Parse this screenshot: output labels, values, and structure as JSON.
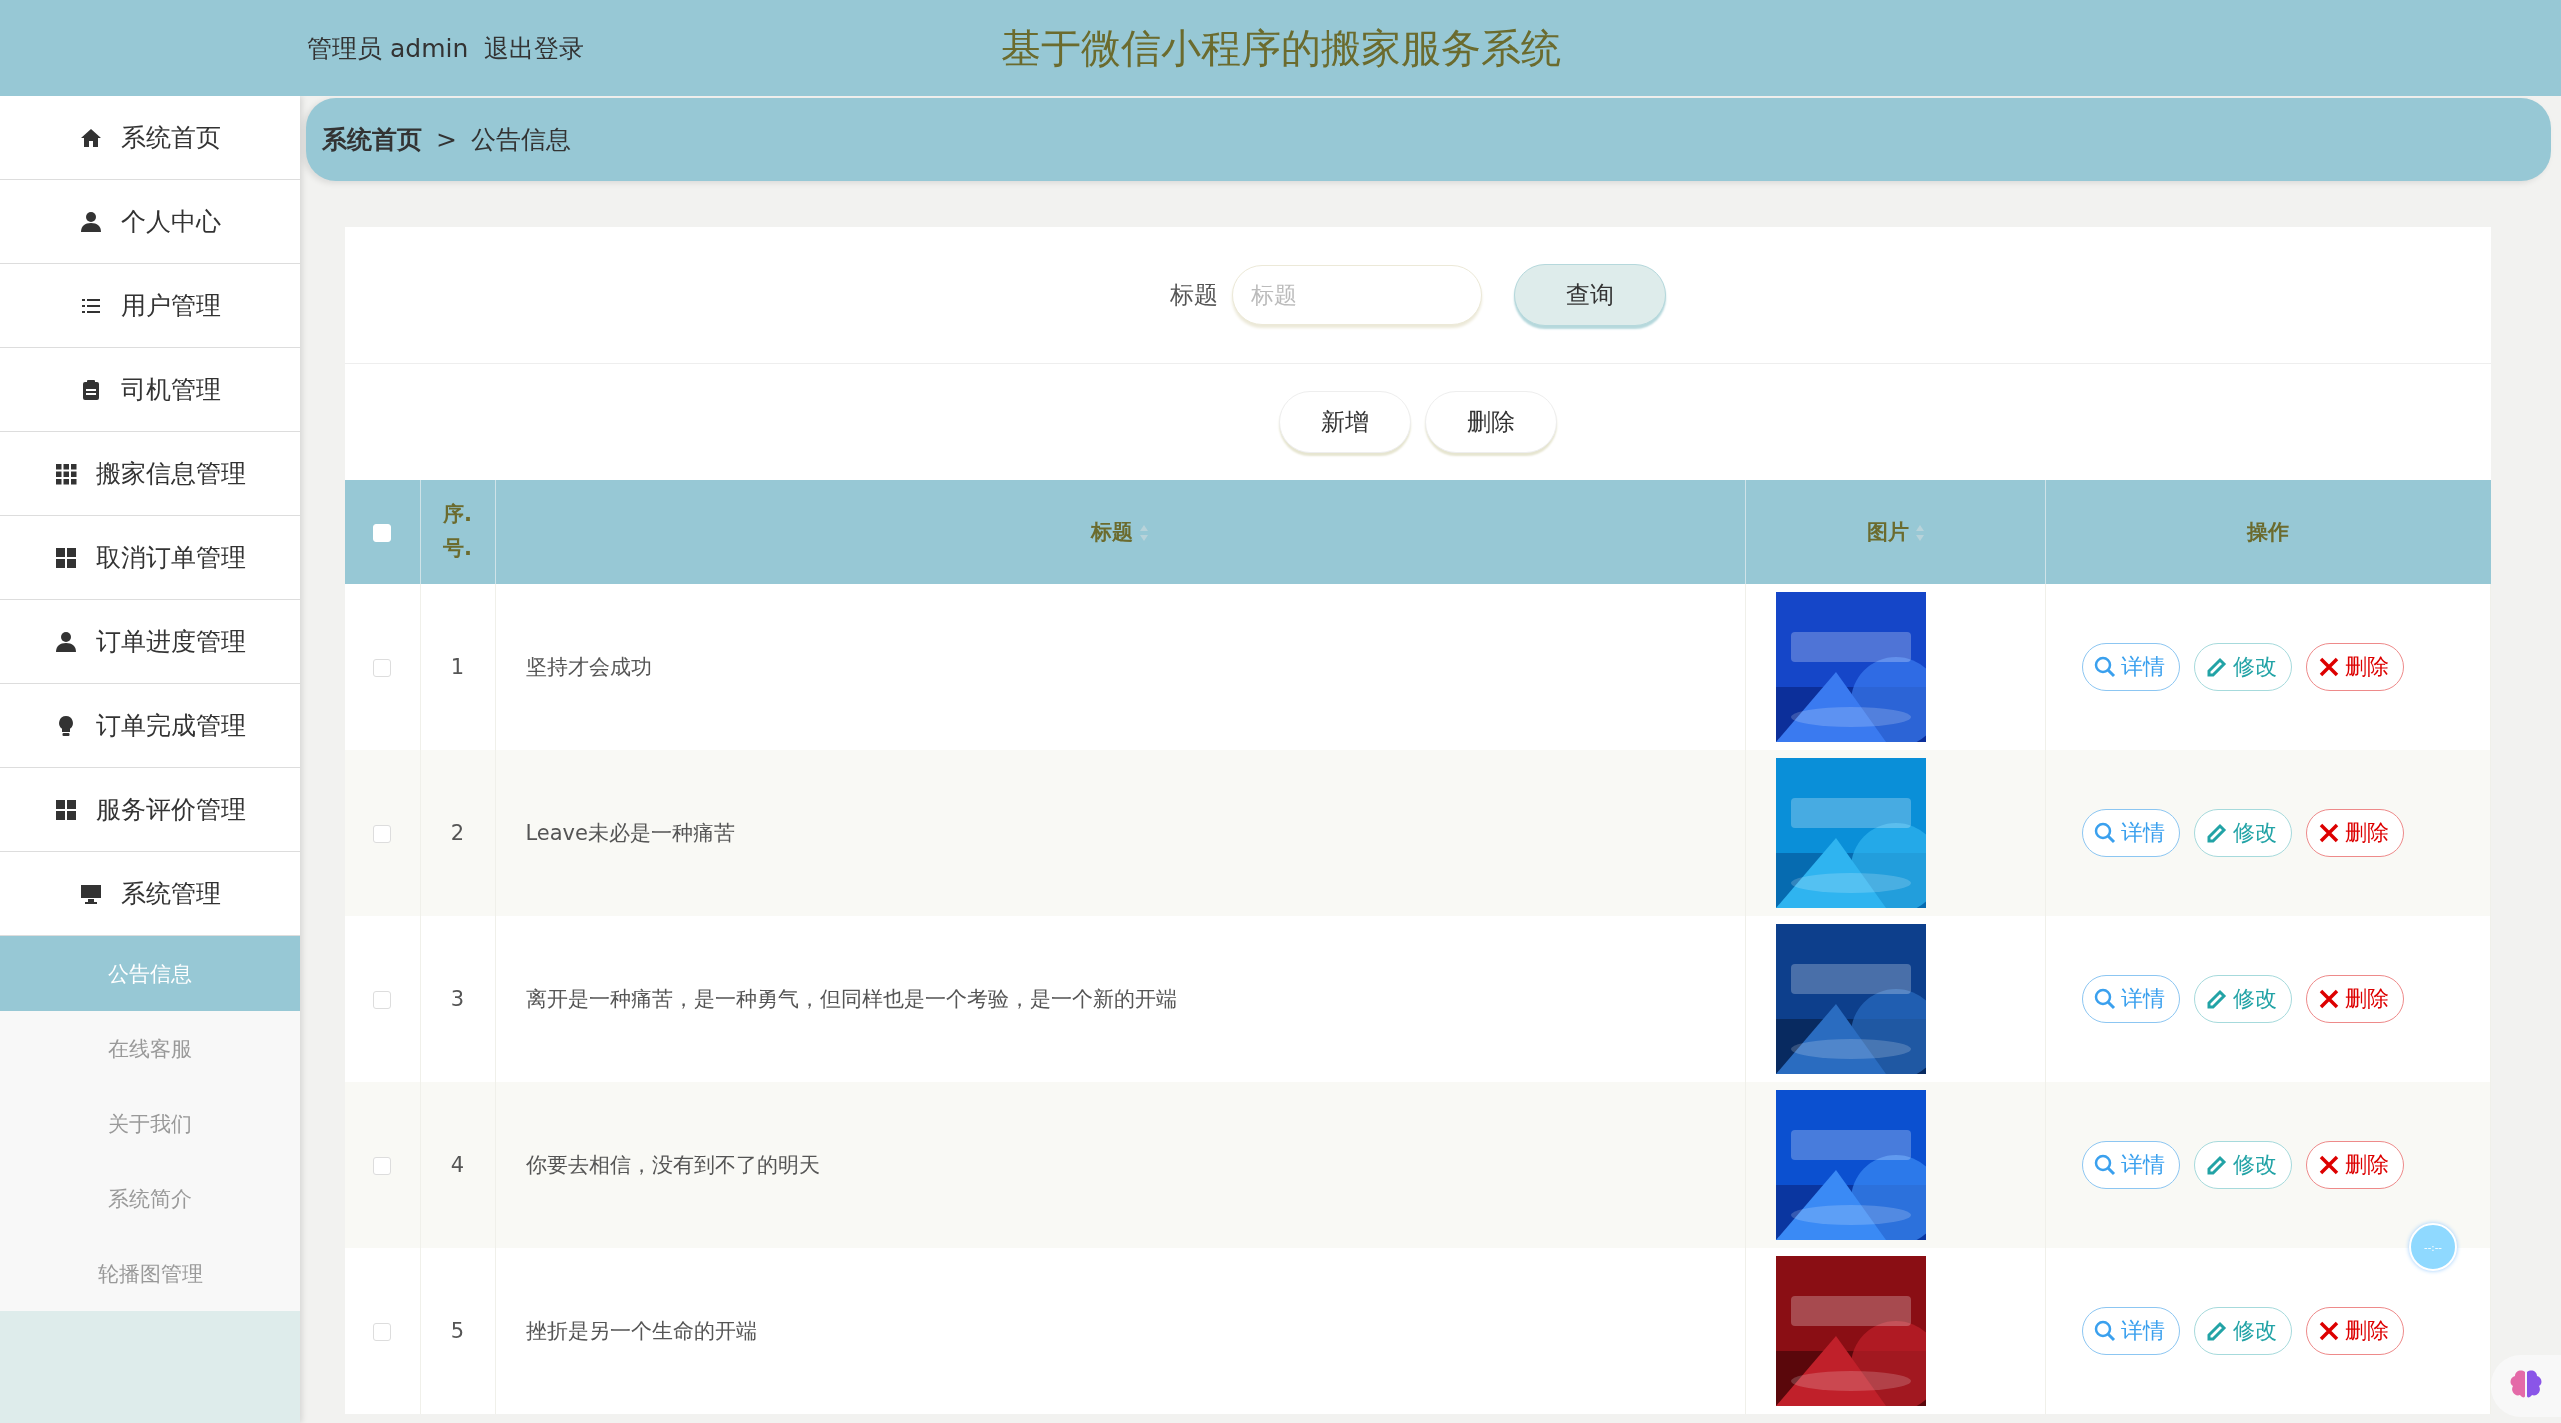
{
  "header": {
    "user_label": "管理员 admin",
    "logout": "退出登录",
    "title": "基于微信小程序的搬家服务系统"
  },
  "sidebar": {
    "items": [
      {
        "label": "系统首页",
        "selected": false
      },
      {
        "label": "个人中心",
        "selected": false
      },
      {
        "label": "用户管理",
        "selected": false
      },
      {
        "label": "司机管理",
        "selected": false
      },
      {
        "label": "搬家信息管理",
        "selected": false
      },
      {
        "label": "取消订单管理",
        "selected": false
      },
      {
        "label": "订单进度管理",
        "selected": false
      },
      {
        "label": "订单完成管理",
        "selected": false
      },
      {
        "label": "服务评价管理",
        "selected": false
      },
      {
        "label": "系统管理",
        "selected": false,
        "children": [
          {
            "label": "公告信息",
            "selected": true
          },
          {
            "label": "在线客服",
            "selected": false
          },
          {
            "label": "关于我们",
            "selected": false
          },
          {
            "label": "系统简介",
            "selected": false
          },
          {
            "label": "轮播图管理",
            "selected": false
          }
        ]
      }
    ]
  },
  "breadcrumb": [
    "系统首页",
    "公告信息"
  ],
  "breadcrumb_separator": ">",
  "search": {
    "label": "标题",
    "placeholder": "标题",
    "button": "查询"
  },
  "actions": [
    "新增",
    "删除"
  ],
  "table": {
    "columns": [
      {
        "kind": "checkbox",
        "checked": false
      },
      {
        "label": "序.号.",
        "kind": "index"
      },
      {
        "label": "标题",
        "kind": "sortable"
      },
      {
        "label": "图片",
        "kind": "sortable"
      },
      {
        "label": "操作",
        "kind": "plain"
      }
    ],
    "rows": [
      {
        "checked": false,
        "index": "1",
        "title": "坚持才会成功",
        "actions": [
          {
            "label": "详情",
            "kind": "detail"
          },
          {
            "label": "修改",
            "kind": "edit"
          },
          {
            "label": "删除",
            "kind": "delete"
          }
        ]
      },
      {
        "checked": false,
        "index": "2",
        "title": "Leave未必是一种痛苦",
        "actions": [
          {
            "label": "详情",
            "kind": "detail"
          },
          {
            "label": "修改",
            "kind": "edit"
          },
          {
            "label": "删除",
            "kind": "delete"
          }
        ]
      },
      {
        "checked": false,
        "index": "3",
        "title": "离开是一种痛苦，是一种勇气，但同样也是一个考验，是一个新的开端",
        "actions": [
          {
            "label": "详情",
            "kind": "detail"
          },
          {
            "label": "修改",
            "kind": "edit"
          },
          {
            "label": "删除",
            "kind": "delete"
          }
        ]
      },
      {
        "checked": false,
        "index": "4",
        "title": "你要去相信，没有到不了的明天",
        "actions": [
          {
            "label": "详情",
            "kind": "detail"
          },
          {
            "label": "修改",
            "kind": "edit"
          },
          {
            "label": "删除",
            "kind": "delete"
          }
        ]
      },
      {
        "checked": false,
        "index": "5",
        "title": "挫折是另一个生命的开端",
        "actions": [
          {
            "label": "详情",
            "kind": "detail"
          },
          {
            "label": "修改",
            "kind": "edit"
          },
          {
            "label": "删除",
            "kind": "delete"
          }
        ]
      }
    ]
  },
  "player": {
    "time": "--:--"
  }
}
